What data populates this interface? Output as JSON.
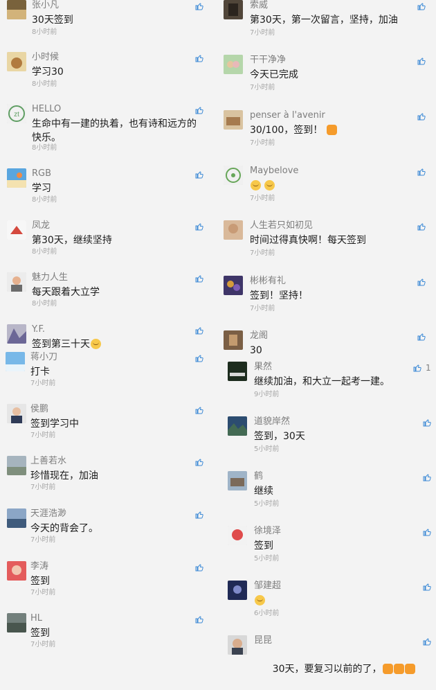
{
  "theme": {
    "like_icon_color": "#3c8ad6"
  },
  "left": [
    {
      "name": "张小凡",
      "text": "30天签到",
      "time": "8小时前",
      "icon": "thumbs-up-icon"
    },
    {
      "name": "小时候",
      "text": "学习30",
      "time": "8小时前",
      "icon": "thumbs-up-icon"
    },
    {
      "name": "HELLO",
      "text": "生命中有一建的执着，也有诗和远方的快乐。",
      "time": "8小时前",
      "icon": "thumbs-up-icon"
    },
    {
      "name": "RGB",
      "text": "学习",
      "time": "8小时前",
      "icon": "thumbs-up-icon"
    },
    {
      "name": "凤龙",
      "text": "第30天，继续坚持",
      "time": "8小时前",
      "icon": "thumbs-up-icon"
    },
    {
      "name": "魅力人生",
      "text": "每天跟着大立学",
      "time": "8小时前",
      "icon": "thumbs-up-icon"
    },
    {
      "name": "Y.F.",
      "text": "签到第三十天",
      "time": "",
      "emoji": "smile-emoji",
      "icon": "thumbs-up-icon"
    },
    {
      "name": "蒋小刀",
      "text": "打卡",
      "time": "7小时前",
      "icon": "thumbs-up-icon"
    },
    {
      "name": "侯鹏",
      "text": "签到学习中",
      "time": "7小时前",
      "icon": "thumbs-up-icon"
    },
    {
      "name": "上善若水",
      "text": "珍惜现在，加油",
      "time": "7小时前",
      "icon": "thumbs-up-icon"
    },
    {
      "name": "天涯浩渺",
      "text": "今天的背会了。",
      "time": "7小时前",
      "icon": "thumbs-up-icon"
    },
    {
      "name": "李涛",
      "text": "签到",
      "time": "7小时前",
      "icon": "thumbs-up-icon"
    },
    {
      "name": "HL",
      "text": "签到",
      "time": "7小时前",
      "icon": "thumbs-up-icon"
    }
  ],
  "right": [
    {
      "name": "索威",
      "text": "第30天，第一次留言，坚持，加油",
      "time": "7小时前",
      "icon": "thumbs-up-icon"
    },
    {
      "name": "干干净净",
      "text": "今天已完成",
      "time": "7小时前",
      "icon": "thumbs-up-icon"
    },
    {
      "name": "penser à l'avenir",
      "text": "30/100，签到！",
      "time": "7小时前",
      "emoji": "fist-emoji",
      "icon": "thumbs-up-icon"
    },
    {
      "name": "Maybelove",
      "text": "",
      "time": "7小时前",
      "emoji": "two-blush-emoji",
      "icon": "thumbs-up-icon"
    },
    {
      "name": "人生若只如初见",
      "text": "时间过得真快啊！每天签到",
      "time": "7小时前",
      "icon": "thumbs-up-icon"
    },
    {
      "name": "彬彬有礼",
      "text": "签到！坚持！",
      "time": "7小时前",
      "icon": "thumbs-up-icon"
    },
    {
      "name": "龙阁",
      "text": "30",
      "time": "",
      "icon": "thumbs-up-icon"
    },
    {
      "name": "果然",
      "text": "继续加油，和大立一起考一建。",
      "time": "9小时前",
      "icon": "thumbs-up-icon",
      "likes": "1"
    },
    {
      "name": "道貌岸然",
      "text": "签到，30天",
      "time": "5小时前",
      "icon": "thumbs-up-icon"
    },
    {
      "name": "鹤",
      "text": "继续",
      "time": "5小时前",
      "icon": "thumbs-up-icon"
    },
    {
      "name": "徐境泽",
      "text": "签到",
      "time": "5小时前",
      "icon": "thumbs-up-icon"
    },
    {
      "name": "邹建超",
      "text": "",
      "time": "6小时前",
      "emoji": "smile-emoji",
      "icon": "thumbs-up-icon"
    },
    {
      "name": "昆昆",
      "text": "30天，要复习以前的了，",
      "time": "",
      "emoji": "three-fist-emoji",
      "icon": "thumbs-up-icon"
    }
  ]
}
